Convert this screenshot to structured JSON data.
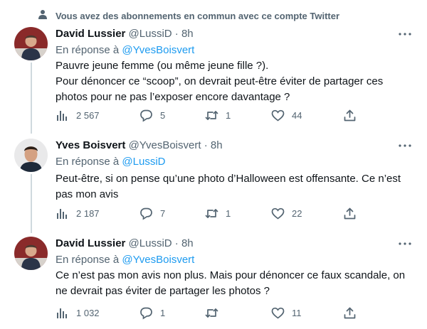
{
  "context": {
    "text": "Vous avez des abonnements en commun avec ce compte Twitter"
  },
  "tweets": [
    {
      "name": "David Lussier",
      "handle": "@LussiD",
      "dot": "·",
      "time": "8h",
      "reply_prefix": "En réponse à",
      "reply_mention": "@YvesBoisvert",
      "lines": [
        "Pauvre jeune femme (ou même jeune fille ?).",
        "Pour dénoncer ce “scoop”, on devrait peut-être éviter de partager ces",
        "photos pour ne pas l’exposer encore davantage ?"
      ],
      "stats": {
        "views": "2 567",
        "replies": "5",
        "retweets": "1",
        "likes": "44"
      },
      "avatar_icon": "avatar-photo"
    },
    {
      "name": "Yves Boisvert",
      "handle": "@YvesBoisvert",
      "dot": "·",
      "time": "8h",
      "reply_prefix": "En réponse à",
      "reply_mention": "@LussiD",
      "lines": [
        "Peut-être, si on pense qu’une photo d’Halloween est offensante. Ce n’est",
        "pas mon avis"
      ],
      "stats": {
        "views": "2 187",
        "replies": "7",
        "retweets": "1",
        "likes": "22"
      },
      "avatar_icon": "avatar-photo"
    },
    {
      "name": "David Lussier",
      "handle": "@LussiD",
      "dot": "·",
      "time": "8h",
      "reply_prefix": "En réponse à",
      "reply_mention": "@YvesBoisvert",
      "lines": [
        "Ce n’est pas mon avis non plus. Mais pour dénoncer ce faux scandale, on",
        "ne devrait pas éviter de partager les photos ?"
      ],
      "stats": {
        "views": "1 032",
        "replies": "1",
        "retweets": "",
        "likes": "11"
      },
      "avatar_icon": "avatar-photo"
    }
  ],
  "colors": {
    "text": "#0f1419",
    "secondary": "#536471",
    "link": "#1d9bf0",
    "thread": "#cfd9de"
  }
}
